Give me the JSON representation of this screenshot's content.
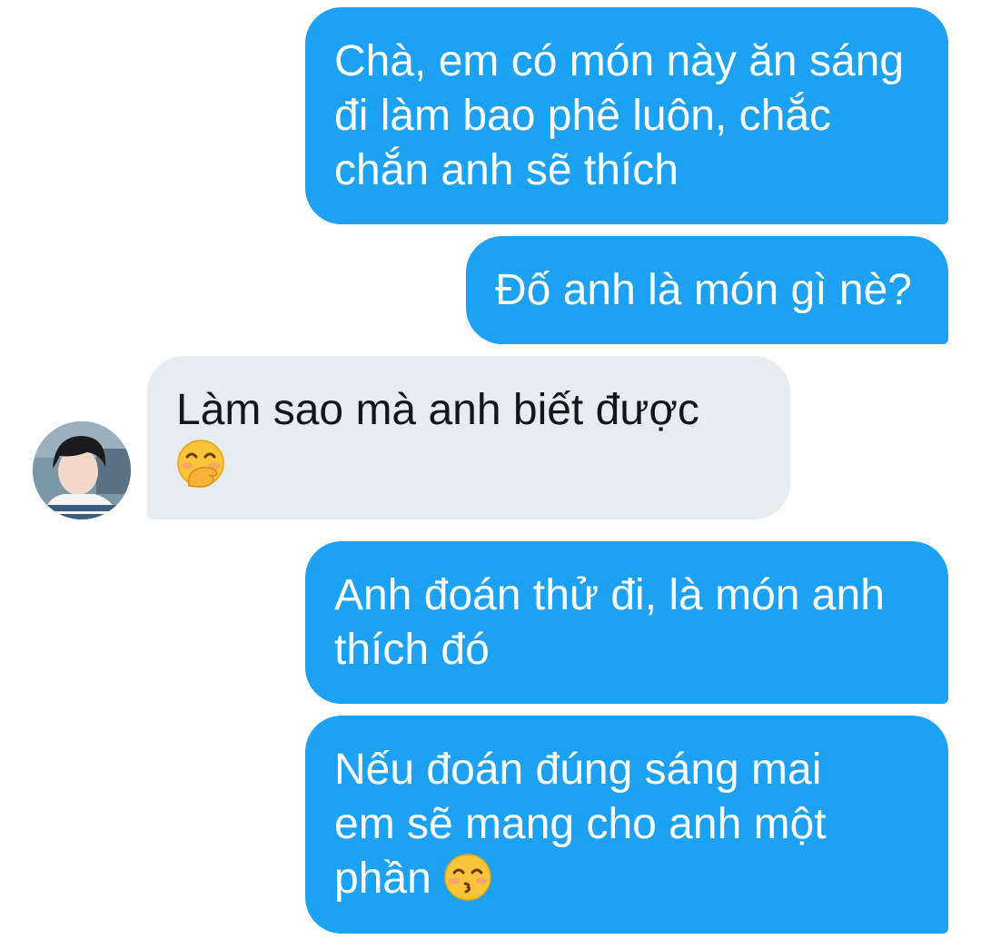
{
  "chat": {
    "colors": {
      "outgoing_bubble": "#1da1f2",
      "incoming_bubble": "#e6ecf0",
      "outgoing_text": "#ffffff",
      "incoming_text": "#14171a"
    },
    "messages": [
      {
        "direction": "outgoing",
        "text": "Chà, em có món này ăn sáng\nđi làm bao phê luôn, chắc\nchắn anh sẽ thích"
      },
      {
        "direction": "outgoing",
        "text": "Đố anh là món gì nè?"
      },
      {
        "direction": "incoming",
        "text": "Làm sao mà anh biết được\n",
        "emoji": "face-with-hand-over-mouth"
      },
      {
        "direction": "outgoing",
        "text": "Anh đoán thử đi, là món anh\nthích đó"
      },
      {
        "direction": "outgoing",
        "text": "Nếu đoán đúng sáng mai\nem sẽ mang cho anh một\nphần ",
        "emoji": "kissing-face-with-smiling-eyes"
      }
    ]
  }
}
